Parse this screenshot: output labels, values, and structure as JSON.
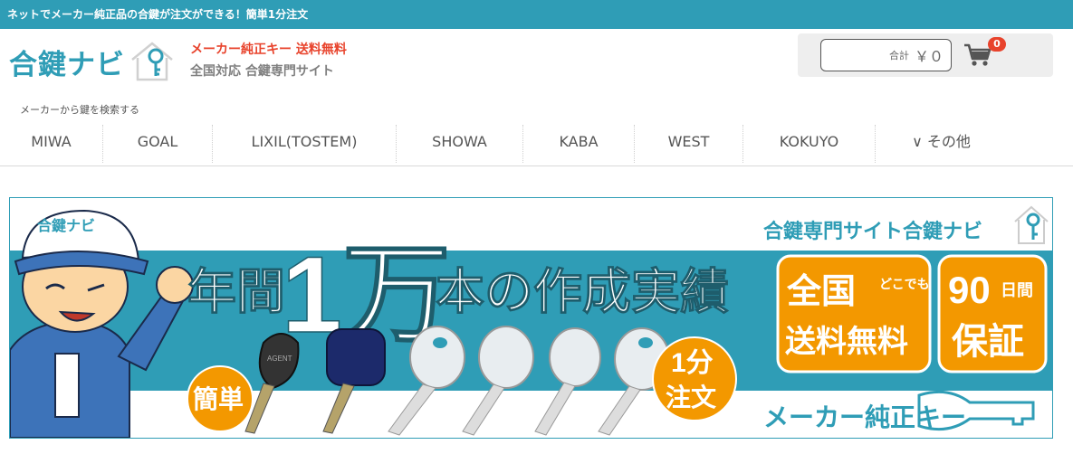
{
  "topbar": {
    "text": "ネットでメーカー純正品の合鍵が注文ができる！簡単1分注文"
  },
  "header": {
    "logo_text": "合鍵ナビ",
    "tagline1": "メーカー純正キー 送料無料",
    "tagline2": "全国対応 合鍵専門サイト"
  },
  "cart": {
    "total_label": "合計",
    "total_value": "￥０",
    "count": "0"
  },
  "search": {
    "label": "メーカーから鍵を検索する"
  },
  "nav": {
    "items": [
      {
        "label": "MIWA"
      },
      {
        "label": "GOAL"
      },
      {
        "label": "LIXIL(TOSTEM)"
      },
      {
        "label": "SHOWA"
      },
      {
        "label": "KABA"
      },
      {
        "label": "WEST"
      },
      {
        "label": "KOKUYO"
      },
      {
        "label": "∨ その他"
      }
    ]
  },
  "banner": {
    "cap_logo": "合鍵ナビ",
    "brand": "合鍵専門サイト合鍵ナビ",
    "headline_pre": "年間",
    "headline_big": "1万",
    "headline_post": "本の作成実績",
    "badge_easy": "簡単",
    "badge_1min_a": "1分",
    "badge_1min_b": "注文",
    "shipping_a": "全国",
    "shipping_b": "どこでも",
    "shipping_c": "送料無料",
    "warranty_a": "90",
    "warranty_b": "日間",
    "warranty_c": "保証",
    "footer": "メーカー純正キー",
    "key_brand": "AGENT"
  },
  "colors": {
    "accent": "#2f9db6",
    "orange": "#f39800",
    "red": "#e8432c"
  }
}
